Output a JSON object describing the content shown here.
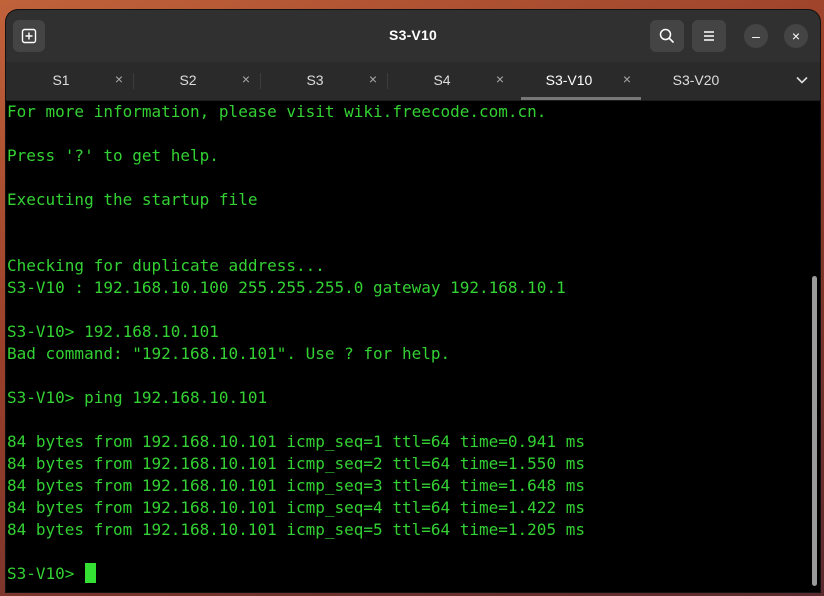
{
  "window": {
    "title": "S3-V10"
  },
  "titlebar": {
    "new_tab_icon": "new-tab-icon",
    "search_icon": "search-icon",
    "menu_icon": "hamburger-menu-icon",
    "minimize_glyph": "–",
    "close_glyph": "×"
  },
  "tabs": [
    {
      "label": "S1",
      "close": "×"
    },
    {
      "label": "S2",
      "close": "×"
    },
    {
      "label": "S3",
      "close": "×"
    },
    {
      "label": "S4",
      "close": "×"
    },
    {
      "label": "S3-V10",
      "close": "×"
    },
    {
      "label": "S3-V20",
      "close": ""
    }
  ],
  "terminal": {
    "lines": [
      "For more information, please visit wiki.freecode.com.cn.",
      "",
      "Press '?' to get help.",
      "",
      "Executing the startup file",
      "",
      "",
      "Checking for duplicate address...",
      "S3-V10 : 192.168.10.100 255.255.255.0 gateway 192.168.10.1",
      "",
      "S3-V10> 192.168.10.101",
      "Bad command: \"192.168.10.101\". Use ? for help.",
      "",
      "S3-V10> ping 192.168.10.101",
      "",
      "84 bytes from 192.168.10.101 icmp_seq=1 ttl=64 time=0.941 ms",
      "84 bytes from 192.168.10.101 icmp_seq=2 ttl=64 time=1.550 ms",
      "84 bytes from 192.168.10.101 icmp_seq=3 ttl=64 time=1.648 ms",
      "84 bytes from 192.168.10.101 icmp_seq=4 ttl=64 time=1.422 ms",
      "84 bytes from 192.168.10.101 icmp_seq=5 ttl=64 time=1.205 ms",
      "",
      "S3-V10> "
    ],
    "text_color": "#33d133",
    "background": "#000000"
  },
  "colors": {
    "titlebar": "#303030",
    "tabbar": "#2a2a2a",
    "accent_tab_underline": "#777777"
  }
}
